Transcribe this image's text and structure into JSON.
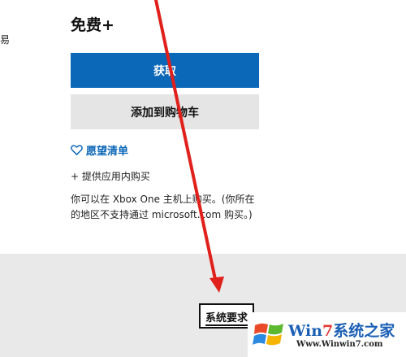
{
  "left_fragment": "易",
  "product": {
    "price": "免费+",
    "get_button": "获取",
    "cart_button": "添加到购物车",
    "wishlist_label": "愿望清单",
    "in_app_purchases": "+ 提供应用内购买",
    "description": "你可以在 Xbox One 主机上购买。(你所在的地区不支持通过 microsoft.com 购买。)"
  },
  "system_requirements": {
    "label": "系统要求"
  },
  "annotation": {
    "arrow_color": "#e0211b"
  },
  "watermark": {
    "brand_prefix": "Win",
    "brand_seven": "7",
    "brand_suffix": "系统之家",
    "url": "Www.Winwin7.com"
  },
  "colors": {
    "primary_blue": "#0b67b8",
    "secondary_gray": "#e5e5e5",
    "background_gray": "#e9e9e9"
  }
}
